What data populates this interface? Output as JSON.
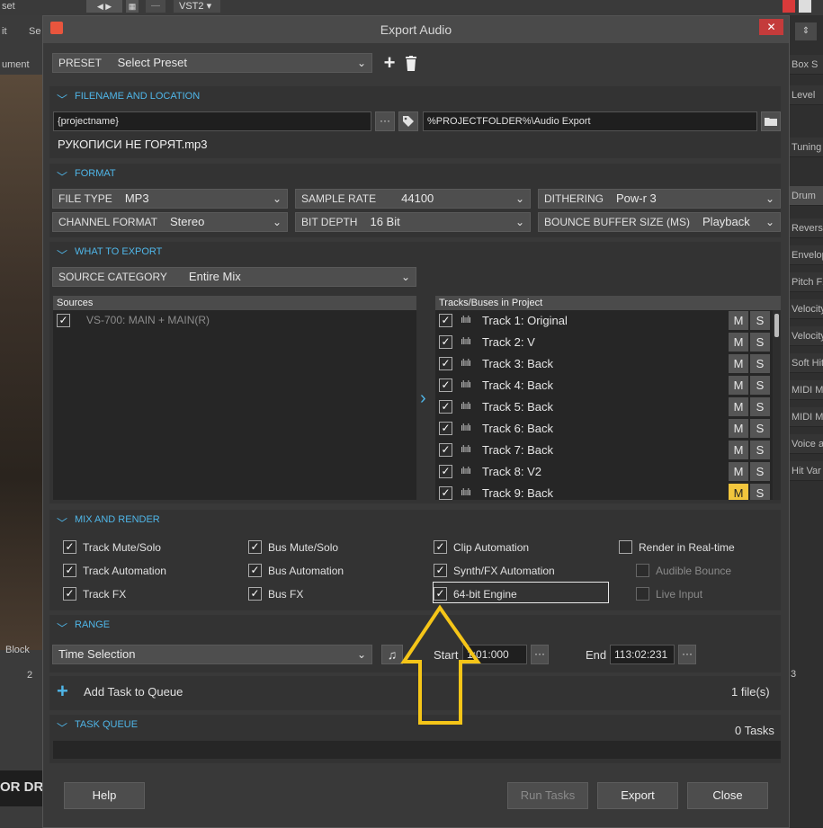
{
  "background": {
    "top_fragment": "set",
    "top_plugin": "VST2",
    "left_items": [
      "it",
      "ument",
      "Block"
    ],
    "left_ruler_mark": "2",
    "mid_item": "Se",
    "bottom_left_text": "OR DR",
    "right_items": [
      "Box S",
      "Level",
      "Tuning",
      "Drum",
      "Reverse",
      "Envelop",
      "Pitch FX",
      "Velocity",
      "Velocity",
      "Soft Hit",
      "MIDI M",
      "MIDI M",
      "Voice a",
      "Hit Var"
    ],
    "right_ruler_mark": "3"
  },
  "dialog": {
    "title": "Export Audio",
    "close_glyph": "✕"
  },
  "preset": {
    "label": "PRESET",
    "value": "Select Preset",
    "add_glyph": "+",
    "delete_glyph": "🗑"
  },
  "filename_section": {
    "header": "FILENAME AND LOCATION",
    "name_value": "{projectname}",
    "more_glyph": "···",
    "path_value": "%PROJECTFOLDER%\\Audio Export",
    "result_filename": "РУКОПИСИ НЕ ГОРЯТ.mp3"
  },
  "format_section": {
    "header": "FORMAT",
    "file_type": {
      "label": "FILE TYPE",
      "value": "MP3"
    },
    "sample_rate": {
      "label": "SAMPLE RATE",
      "value": "44100"
    },
    "dithering": {
      "label": "DITHERING",
      "value": "Pow-r 3"
    },
    "channel_format": {
      "label": "CHANNEL FORMAT",
      "value": "Stereo"
    },
    "bit_depth": {
      "label": "BIT DEPTH",
      "value": "16 Bit"
    },
    "bounce_buffer": {
      "label": "BOUNCE BUFFER SIZE (MS)",
      "value": "Playback"
    }
  },
  "what_section": {
    "header": "WHAT TO EXPORT",
    "source_category": {
      "label": "SOURCE CATEGORY",
      "value": "Entire Mix"
    },
    "sources_header": "Sources",
    "sources": [
      {
        "label": "VS-700: MAIN + MAIN(R)",
        "checked": true
      }
    ],
    "tracks_header": "Tracks/Buses in Project",
    "tracks": [
      {
        "name": "Track 1: Original",
        "checked": true,
        "m": "M",
        "s": "S",
        "mute_active": false
      },
      {
        "name": "Track 2: V",
        "checked": true,
        "m": "M",
        "s": "S",
        "mute_active": false
      },
      {
        "name": "Track 3: Back",
        "checked": true,
        "m": "M",
        "s": "S",
        "mute_active": false
      },
      {
        "name": "Track 4: Back",
        "checked": true,
        "m": "M",
        "s": "S",
        "mute_active": false
      },
      {
        "name": "Track 5: Back",
        "checked": true,
        "m": "M",
        "s": "S",
        "mute_active": false
      },
      {
        "name": "Track 6: Back",
        "checked": true,
        "m": "M",
        "s": "S",
        "mute_active": false
      },
      {
        "name": "Track 7: Back",
        "checked": true,
        "m": "M",
        "s": "S",
        "mute_active": false
      },
      {
        "name": "Track 8: V2",
        "checked": true,
        "m": "M",
        "s": "S",
        "mute_active": false
      },
      {
        "name": "Track 9: Back",
        "checked": true,
        "m": "M",
        "s": "S",
        "mute_active": true
      }
    ]
  },
  "mix_section": {
    "header": "MIX AND RENDER",
    "options": [
      {
        "label": "Track Mute/Solo",
        "checked": true,
        "enabled": true
      },
      {
        "label": "Track Automation",
        "checked": true,
        "enabled": true
      },
      {
        "label": "Track FX",
        "checked": true,
        "enabled": true
      },
      {
        "label": "Bus Mute/Solo",
        "checked": true,
        "enabled": true
      },
      {
        "label": "Bus Automation",
        "checked": true,
        "enabled": true
      },
      {
        "label": "Bus FX",
        "checked": true,
        "enabled": true
      },
      {
        "label": "Clip Automation",
        "checked": true,
        "enabled": true
      },
      {
        "label": "Synth/FX Automation",
        "checked": true,
        "enabled": true
      },
      {
        "label": "64-bit Engine",
        "checked": true,
        "enabled": true
      },
      {
        "label": "Render in Real-time",
        "checked": false,
        "enabled": true
      },
      {
        "label": "Audible Bounce",
        "checked": false,
        "enabled": false
      },
      {
        "label": "Live Input",
        "checked": false,
        "enabled": false
      }
    ]
  },
  "range_section": {
    "header": "RANGE",
    "range_value": "Time Selection",
    "start_label": "Start",
    "start_value": "1:01:000",
    "end_label": "End",
    "end_value": "113:02:231"
  },
  "queue": {
    "add_label": "Add Task to Queue",
    "file_count": "1 file(s)",
    "header": "TASK QUEUE",
    "task_count": "0 Tasks"
  },
  "footer": {
    "help": "Help",
    "run_tasks": "Run Tasks",
    "export": "Export",
    "close": "Close"
  },
  "colors": {
    "accent": "#4fb6e8",
    "highlight_arrow": "#f5c518",
    "mute_active": "#f2c63d"
  }
}
